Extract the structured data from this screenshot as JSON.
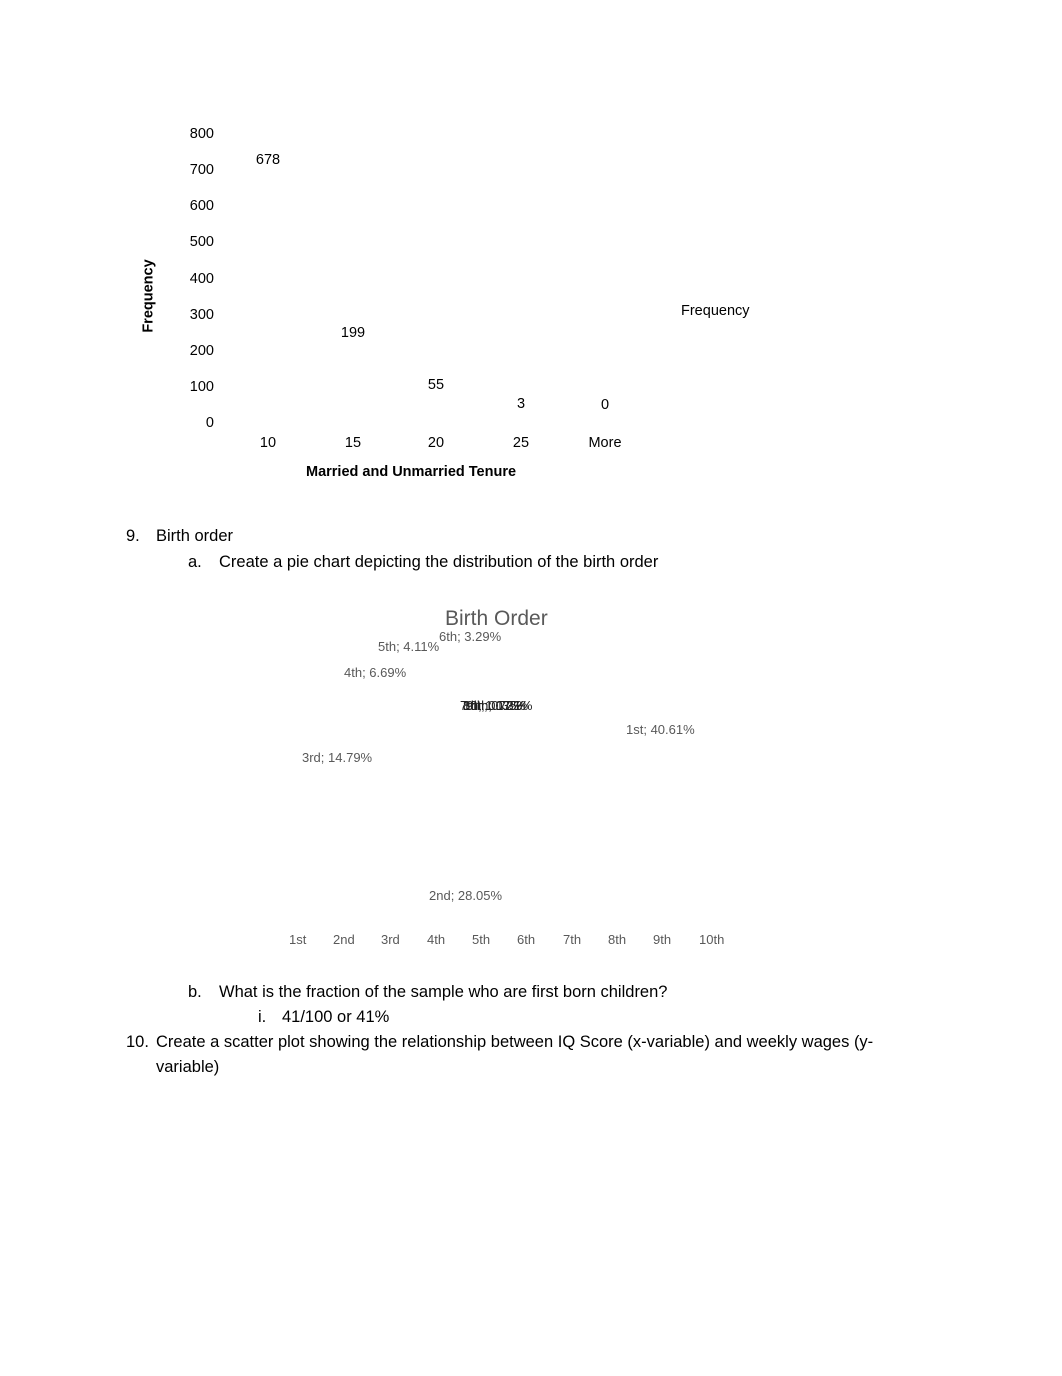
{
  "chart_data": [
    {
      "type": "bar",
      "title": "",
      "xlabel": "Married and Unmarried Tenure",
      "ylabel": "Frequency",
      "categories": [
        "10",
        "15",
        "20",
        "25",
        "More"
      ],
      "values": [
        678,
        199,
        55,
        3,
        0
      ],
      "data_labels": [
        "678",
        "199",
        "55",
        "3",
        "0"
      ],
      "yticks": [
        "0",
        "100",
        "200",
        "300",
        "400",
        "500",
        "600",
        "700",
        "800"
      ],
      "ylim": [
        0,
        800
      ],
      "legend": [
        "Frequency"
      ],
      "legend_position": "right",
      "grid": false
    },
    {
      "type": "pie",
      "title": "Birth Order",
      "categories": [
        "1st",
        "2nd",
        "3rd",
        "4th",
        "5th",
        "6th",
        "7th",
        "8th",
        "9th",
        "10th"
      ],
      "values": [
        40.61,
        28.05,
        14.79,
        6.69,
        4.11,
        3.29,
        1.17,
        0.73,
        0.35,
        0.21
      ],
      "labels": [
        "1st; 40.61%",
        "2nd; 28.05%",
        "3rd; 14.79%",
        "4th; 6.69%",
        "5th; 4.11%",
        "6th; 3.29%",
        "7th; 1.17%",
        "8th; 0.73%",
        "9th; 0.35%",
        "10th; 0.21%"
      ],
      "legend_position": "bottom"
    }
  ],
  "document": {
    "q9_number": "9.",
    "q9_text": "Birth order",
    "q9a_letter": "a.",
    "q9a_text": "Create a pie chart depicting the distribution of the birth order",
    "q9b_letter": "b.",
    "q9b_text": "What is the fraction of the sample who are first born children?",
    "q9b_i_numeral": "i.",
    "q9b_i_text": "41/100 or 41%",
    "q10_number": "10.",
    "q10_text_line1": "Create a scatter plot showing the relationship between IQ Score (x-variable) and weekly wages (y-",
    "q10_text_line2": "variable)"
  }
}
